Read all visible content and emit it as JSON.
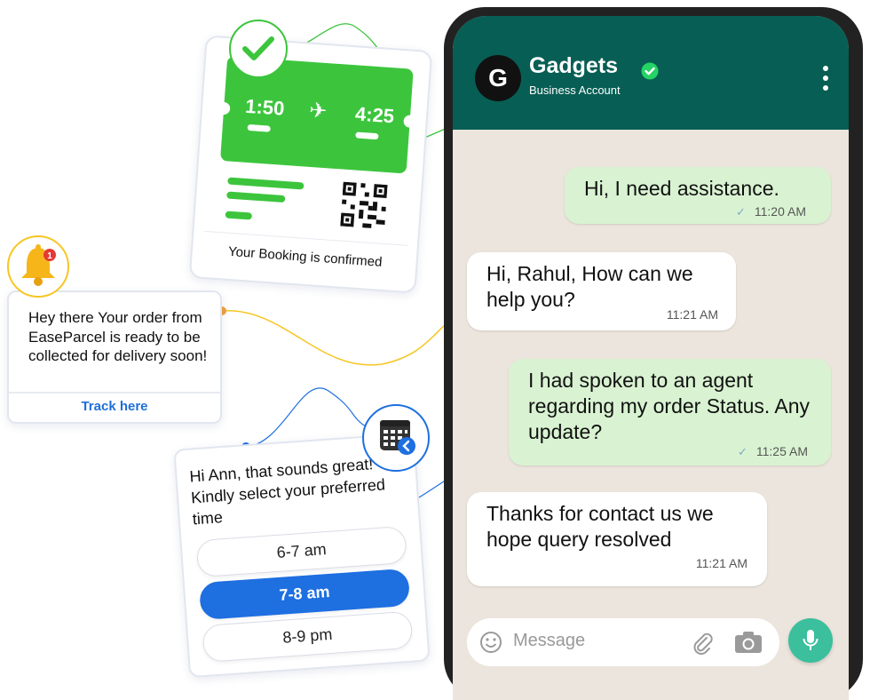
{
  "booking_card": {
    "departure_time": "1:50",
    "arrival_time": "4:25",
    "plane_icon": "airplane-icon",
    "status_text": "Your Booking is confirmed",
    "badge_icon": "checkmark-icon"
  },
  "order_card": {
    "message": "Hey there Your order from EaseParcel is ready to be collected for delivery soon!",
    "action_label": "Track here",
    "badge_icon": "bell-icon",
    "notification_count": "1"
  },
  "slot_card": {
    "message": "Hi Ann, that sounds great! Kindly select your preferred time",
    "options": [
      "6-7 am",
      "7-8 am",
      "8-9 pm"
    ],
    "selected_option": "7-8 am",
    "badge_icon": "calendar-icon"
  },
  "chat_header": {
    "avatar_letter": "G",
    "contact_name": "Gadgets",
    "subtitle": "Business Account",
    "verified_icon": "verified-icon",
    "menu_icon": "more-vertical-icon"
  },
  "messages": [
    {
      "direction": "outgoing",
      "text": "Hi, I need assistance.",
      "time": "11:20 AM",
      "status": "sent"
    },
    {
      "direction": "incoming",
      "text": "Hi, Rahul, How can we help you?",
      "time": "11:21 AM"
    },
    {
      "direction": "outgoing",
      "text": "I had spoken to an agent regarding my order Status. Any update?",
      "time": "11:25 AM",
      "status": "sent"
    },
    {
      "direction": "incoming",
      "text": "Thanks for contact us we hope query resolved",
      "time": "11:21 AM"
    }
  ],
  "composer": {
    "placeholder": "Message",
    "emoji_icon": "emoji-icon",
    "attach_icon": "paperclip-icon",
    "camera_icon": "camera-icon",
    "mic_icon": "microphone-icon"
  },
  "colors": {
    "header_bg": "#075e54",
    "outgoing_bubble": "#d9f3d2",
    "incoming_bubble": "#ffffff",
    "chat_bg": "#ece5dd",
    "success_green": "#3cc53c",
    "link_blue": "#1e6fd9",
    "mic_button": "#3bbf9c",
    "bell_yellow": "#f6c623"
  }
}
